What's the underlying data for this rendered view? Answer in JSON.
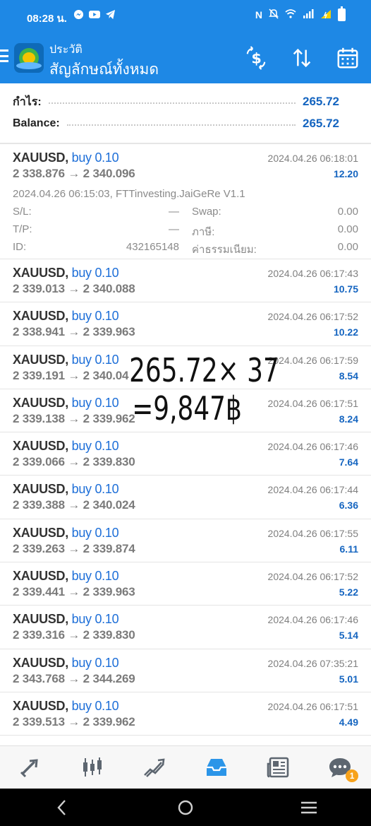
{
  "status_bar": {
    "time": "08:28 น.",
    "app_icons": [
      "messenger-icon",
      "youtube-icon",
      "telegram-icon"
    ],
    "system_icons": [
      "nfc-icon",
      "mute-icon",
      "wifi-icon",
      "signal-icon",
      "battery-saver-icon",
      "battery-icon"
    ]
  },
  "header": {
    "subtitle": "ประวัติ",
    "title": "สัญลักษณ์ทั้งหมด",
    "actions": [
      "currency-filter-icon",
      "sort-icon",
      "calendar-icon"
    ]
  },
  "summary": {
    "profit_label": "กำไร:",
    "profit_value": "265.72",
    "balance_label": "Balance:",
    "balance_value": "265.72"
  },
  "expanded_trade": {
    "symbol": "XAUUSD,",
    "direction": "buy 0.10",
    "prices": "2 338.876 → 2 340.096",
    "time": "2024.04.26 06:18:01",
    "profit": "12.20",
    "open_info": "2024.04.26 06:15:03, FTTinvesting.JaiGeRe V1.1",
    "sl_label": "S/L:",
    "sl_value": "—",
    "swap_label": "Swap:",
    "swap_value": "0.00",
    "tp_label": "T/P:",
    "tp_value": "—",
    "tax_label": "ภาษี:",
    "tax_value": "0.00",
    "id_label": "ID:",
    "id_value": "432165148",
    "fee_label": "ค่าธรรมเนียม:",
    "fee_value": "0.00"
  },
  "trades": [
    {
      "symbol": "XAUUSD,",
      "direction": "buy 0.10",
      "prices": "2 339.013 → 2 340.088",
      "time": "2024.04.26 06:17:43",
      "profit": "10.75"
    },
    {
      "symbol": "XAUUSD,",
      "direction": "buy 0.10",
      "prices": "2 338.941 → 2 339.963",
      "time": "2024.04.26 06:17:52",
      "profit": "10.22"
    },
    {
      "symbol": "XAUUSD,",
      "direction": "buy 0.10",
      "prices": "2 339.191 → 2 340.04",
      "time": "2024.04.26 06:17:59",
      "profit": "8.54"
    },
    {
      "symbol": "XAUUSD,",
      "direction": "buy 0.10",
      "prices": "2 339.138 → 2 339.962",
      "time": "2024.04.26 06:17:51",
      "profit": "8.24"
    },
    {
      "symbol": "XAUUSD,",
      "direction": "buy 0.10",
      "prices": "2 339.066 → 2 339.830",
      "time": "2024.04.26 06:17:46",
      "profit": "7.64"
    },
    {
      "symbol": "XAUUSD,",
      "direction": "buy 0.10",
      "prices": "2 339.388 → 2 340.024",
      "time": "2024.04.26 06:17:44",
      "profit": "6.36"
    },
    {
      "symbol": "XAUUSD,",
      "direction": "buy 0.10",
      "prices": "2 339.263 → 2 339.874",
      "time": "2024.04.26 06:17:55",
      "profit": "6.11"
    },
    {
      "symbol": "XAUUSD,",
      "direction": "buy 0.10",
      "prices": "2 339.441 → 2 339.963",
      "time": "2024.04.26 06:17:52",
      "profit": "5.22"
    },
    {
      "symbol": "XAUUSD,",
      "direction": "buy 0.10",
      "prices": "2 339.316 → 2 339.830",
      "time": "2024.04.26 06:17:46",
      "profit": "5.14"
    },
    {
      "symbol": "XAUUSD,",
      "direction": "buy 0.10",
      "prices": "2 343.768 → 2 344.269",
      "time": "2024.04.26 07:35:21",
      "profit": "5.01"
    },
    {
      "symbol": "XAUUSD,",
      "direction": "buy 0.10",
      "prices": "2 339.513 → 2 339.962",
      "time": "2024.04.26 06:17:51",
      "profit": "4.49"
    }
  ],
  "overlay": {
    "line1": "265.72× 37",
    "line2": "=9,847฿"
  },
  "bottom_nav": {
    "items": [
      "quotes-icon",
      "chart-icon",
      "trade-icon",
      "history-icon",
      "news-icon",
      "messages-icon"
    ],
    "messages_badge": "1"
  },
  "colors": {
    "primary": "#1e88e5",
    "profit": "#1565c0",
    "direction": "#1e6fd8",
    "badge": "#f7a21b"
  }
}
